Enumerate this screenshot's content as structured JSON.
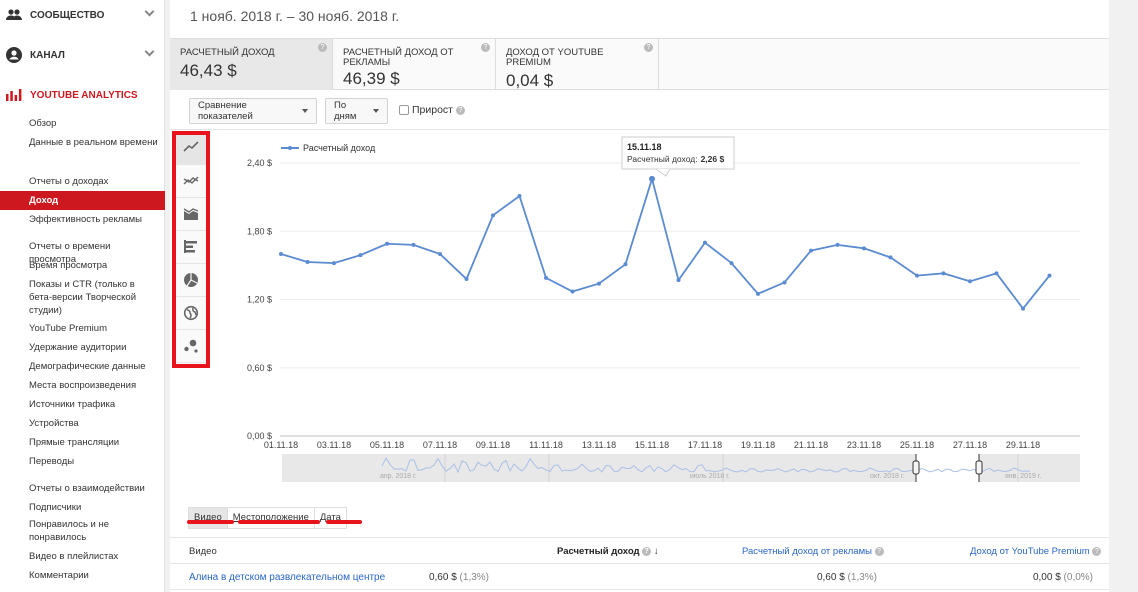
{
  "sidebar": {
    "sections": [
      {
        "label": "Сообщество",
        "icon": "people-icon"
      },
      {
        "label": "Канал",
        "icon": "account-icon"
      },
      {
        "label": "YouTube Analytics",
        "icon": "analytics-bars-icon"
      }
    ],
    "items": [
      {
        "label": "Обзор"
      },
      {
        "label": "Данные в реальном времени"
      },
      {
        "label": "Отчеты о доходах"
      },
      {
        "label": "Доход",
        "active": true
      },
      {
        "label": "Эффективность рекламы"
      },
      {
        "label": "Отчеты о времени просмотра"
      },
      {
        "label": "Время просмотра"
      },
      {
        "label": "Показы и CTR (только в бета-версии Творческой студии)"
      },
      {
        "label": "YouTube Premium"
      },
      {
        "label": "Удержание аудитории"
      },
      {
        "label": "Демографические данные"
      },
      {
        "label": "Места воспроизведения"
      },
      {
        "label": "Источники трафика"
      },
      {
        "label": "Устройства"
      },
      {
        "label": "Прямые трансляции"
      },
      {
        "label": "Переводы"
      },
      {
        "label": "Отчеты о взаимодействии"
      },
      {
        "label": "Подписчики"
      },
      {
        "label": "Понравилось и не понравилось"
      },
      {
        "label": "Видео в плейлистах"
      },
      {
        "label": "Комментарии"
      }
    ]
  },
  "header": {
    "date_range": "1 нояб. 2018 г. – 30 нояб. 2018 г."
  },
  "metrics": [
    {
      "label": "Расчетный доход",
      "value": "46,43 $"
    },
    {
      "label": "Расчетный доход от рекламы",
      "value": "46,39 $"
    },
    {
      "label": "Доход от YouTube Premium",
      "value": "0,04 $"
    }
  ],
  "controls": {
    "compare": "Сравнение показателей",
    "granularity": "По дням",
    "growth": "Прирост",
    "help": "?"
  },
  "chart_icons": [
    "line-chart-icon",
    "multi-line-chart-icon",
    "stacked-area-chart-icon",
    "bar-chart-icon",
    "pie-chart-icon",
    "globe-map-icon",
    "bubble-chart-icon"
  ],
  "chart_data": {
    "type": "line",
    "legend": "Расчетный доход",
    "x": [
      "01.11.18",
      "02.11.18",
      "03.11.18",
      "04.11.18",
      "05.11.18",
      "06.11.18",
      "07.11.18",
      "08.11.18",
      "09.11.18",
      "10.11.18",
      "11.11.18",
      "12.11.18",
      "13.11.18",
      "14.11.18",
      "15.11.18",
      "16.11.18",
      "17.11.18",
      "18.11.18",
      "19.11.18",
      "20.11.18",
      "21.11.18",
      "22.11.18",
      "23.11.18",
      "24.11.18",
      "25.11.18",
      "26.11.18",
      "27.11.18",
      "28.11.18",
      "29.11.18",
      "30.11.18"
    ],
    "values": [
      1.6,
      1.53,
      1.52,
      1.59,
      1.69,
      1.68,
      1.6,
      1.38,
      1.94,
      2.11,
      1.39,
      1.27,
      1.34,
      1.51,
      2.26,
      1.37,
      1.7,
      1.52,
      1.25,
      1.35,
      1.63,
      1.68,
      1.65,
      1.57,
      1.41,
      1.43,
      1.36,
      1.43,
      1.12,
      1.41
    ],
    "ylim": [
      0,
      2.4
    ],
    "yticks": [
      "0,00 $",
      "0,60 $",
      "1,20 $",
      "1,80 $",
      "2,40 $"
    ],
    "xticks": [
      "01.11.18",
      "03.11.18",
      "05.11.18",
      "07.11.18",
      "09.11.18",
      "11.11.18",
      "13.11.18",
      "15.11.18",
      "17.11.18",
      "19.11.18",
      "21.11.18",
      "23.11.18",
      "25.11.18",
      "27.11.18",
      "29.11.18"
    ],
    "tooltip": {
      "date": "15.11.18",
      "label": "Расчетный доход:",
      "value": "2,26 $"
    },
    "navigator_labels": [
      "апр. 2018 г.",
      "июль 2018 г.",
      "окт. 2018 г.",
      "янв. 2019 г."
    ],
    "color": "#5b8bd0"
  },
  "tabs": [
    {
      "label": "Видео"
    },
    {
      "label": "Местоположение"
    },
    {
      "label": "Дата"
    }
  ],
  "table": {
    "headers": [
      "Видео",
      "Расчетный доход",
      "Расчетный доход от рекламы",
      "Доход от YouTube Premium"
    ],
    "rows": [
      {
        "title": "Алина в детском развлекательном центре",
        "c1": "0,60 $",
        "p1": "(1,3%)",
        "c2": "0,60 $",
        "p2": "(1,3%)",
        "c3": "0,00 $",
        "p3": "(0,0%)"
      }
    ]
  }
}
